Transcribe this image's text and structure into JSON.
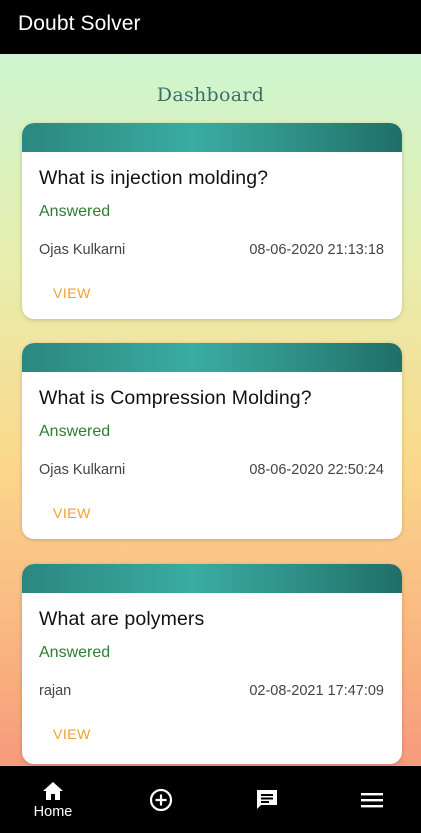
{
  "app": {
    "title": "Doubt Solver"
  },
  "page": {
    "title": "Dashboard"
  },
  "questions": [
    {
      "title": "What is injection molding?",
      "status": "Answered",
      "author": "Ojas Kulkarni",
      "datetime": "08-06-2020 21:13:18",
      "action": "VIEW"
    },
    {
      "title": "What is Compression Molding?",
      "status": "Answered",
      "author": "Ojas Kulkarni",
      "datetime": "08-06-2020 22:50:24",
      "action": "VIEW"
    },
    {
      "title": "What are polymers",
      "status": "Answered",
      "author": "rajan",
      "datetime": "02-08-2021 17:47:09",
      "action": "VIEW"
    }
  ],
  "colors": {
    "appbar": "#000000",
    "card_band": "#2b8780",
    "status": "#2e7d32",
    "view_action": "#f0a030",
    "page_title": "#3d6f69"
  },
  "bottom_nav": [
    {
      "icon": "home-icon",
      "label": "Home"
    },
    {
      "icon": "add-circle-icon",
      "label": ""
    },
    {
      "icon": "chat-icon",
      "label": ""
    },
    {
      "icon": "menu-icon",
      "label": ""
    }
  ]
}
